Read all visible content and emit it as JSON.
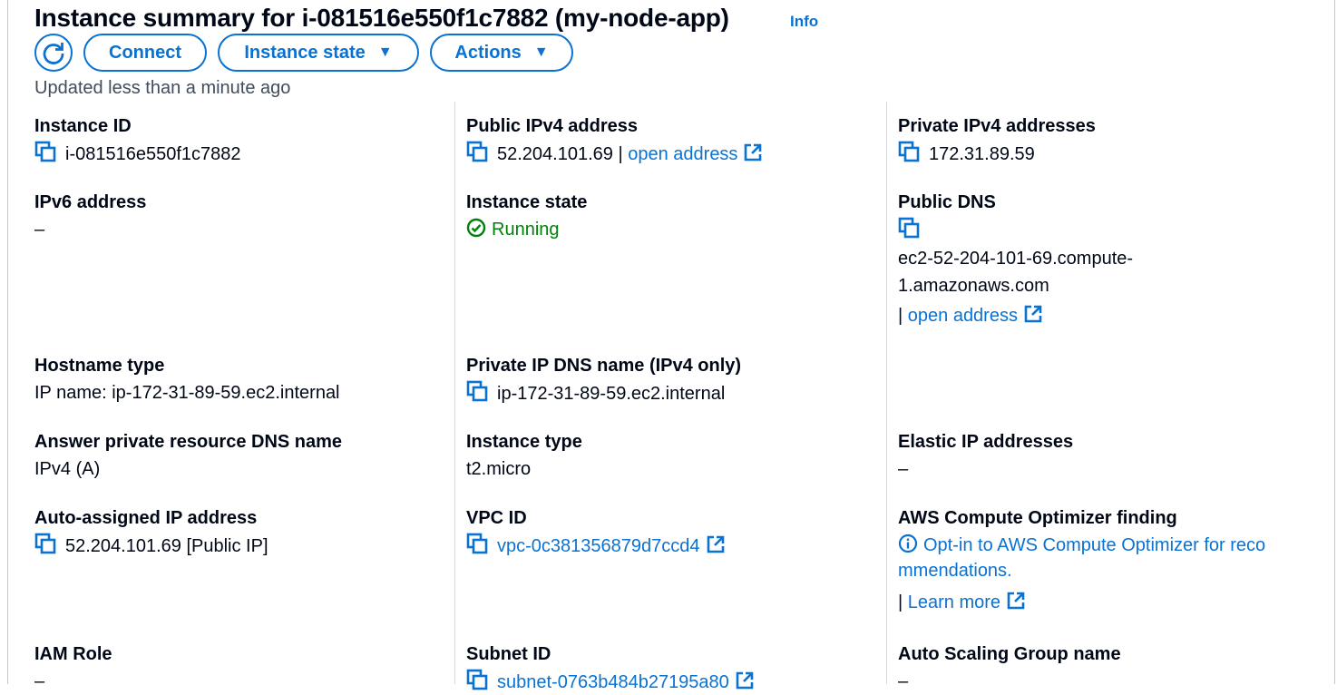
{
  "header": {
    "title": "Instance summary for i-081516e550f1c7882 (my-node-app)",
    "info": "Info",
    "updated": "Updated less than a minute ago"
  },
  "toolbar": {
    "connect": "Connect",
    "instance_state": "Instance state",
    "actions": "Actions"
  },
  "fields": {
    "instance_id": {
      "label": "Instance ID",
      "value": "i-081516e550f1c7882"
    },
    "public_ipv4": {
      "label": "Public IPv4 address",
      "value": "52.204.101.69",
      "sep": "|",
      "link": "open address"
    },
    "private_ipv4": {
      "label": "Private IPv4 addresses",
      "value": "172.31.89.59"
    },
    "ipv6": {
      "label": "IPv6 address",
      "value": "–"
    },
    "instance_state": {
      "label": "Instance state",
      "value": "Running"
    },
    "public_dns": {
      "label": "Public DNS",
      "value_line1": "ec2-52-204-101-69.compute-",
      "value_line2": "1.amazonaws.com",
      "sep": "|",
      "link": "open address"
    },
    "hostname_type": {
      "label": "Hostname type",
      "value": "IP name: ip-172-31-89-59.ec2.internal"
    },
    "private_ip_dns": {
      "label": "Private IP DNS name (IPv4 only)",
      "value": "ip-172-31-89-59.ec2.internal"
    },
    "answer_private_dns": {
      "label": "Answer private resource DNS name",
      "value": "IPv4 (A)"
    },
    "instance_type": {
      "label": "Instance type",
      "value": "t2.micro"
    },
    "elastic_ip": {
      "label": "Elastic IP addresses",
      "value": "–"
    },
    "auto_assigned_ip": {
      "label": "Auto-assigned IP address",
      "value": "52.204.101.69 [Public IP]"
    },
    "vpc_id": {
      "label": "VPC ID",
      "value": "vpc-0c381356879d7ccd4"
    },
    "compute_optimizer": {
      "label": "AWS Compute Optimizer finding",
      "line1": "Opt-in to AWS Compute Optimizer for reco",
      "line2": "mmendations.",
      "sep": "|",
      "link": "Learn more"
    },
    "iam_role": {
      "label": "IAM Role",
      "value": "–"
    },
    "subnet_id": {
      "label": "Subnet ID",
      "value": "subnet-0763b484b27195a80"
    },
    "asg_name": {
      "label": "Auto Scaling Group name",
      "value": "–"
    }
  },
  "colors": {
    "link": "#0972d3",
    "running": "#037f0c",
    "text": "#000716"
  }
}
